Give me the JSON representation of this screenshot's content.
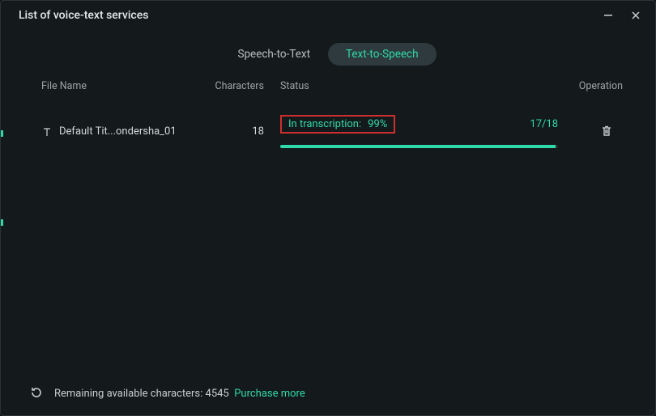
{
  "window": {
    "title": "List of voice-text services"
  },
  "tabs": {
    "stt_label": "Speech-to-Text",
    "tts_label": "Text-to-Speech"
  },
  "headers": {
    "file": "File Name",
    "chars": "Characters",
    "status": "Status",
    "operation": "Operation"
  },
  "row": {
    "file_name": "Default Tit...ondersha_01",
    "characters": "18",
    "status_label": "In transcription:",
    "status_pct": "99%",
    "progress_pct": 99,
    "ratio": "17/18"
  },
  "footer": {
    "remaining_prefix": "Remaining available characters: ",
    "remaining_value": "4545",
    "purchase_label": "Purchase more"
  }
}
